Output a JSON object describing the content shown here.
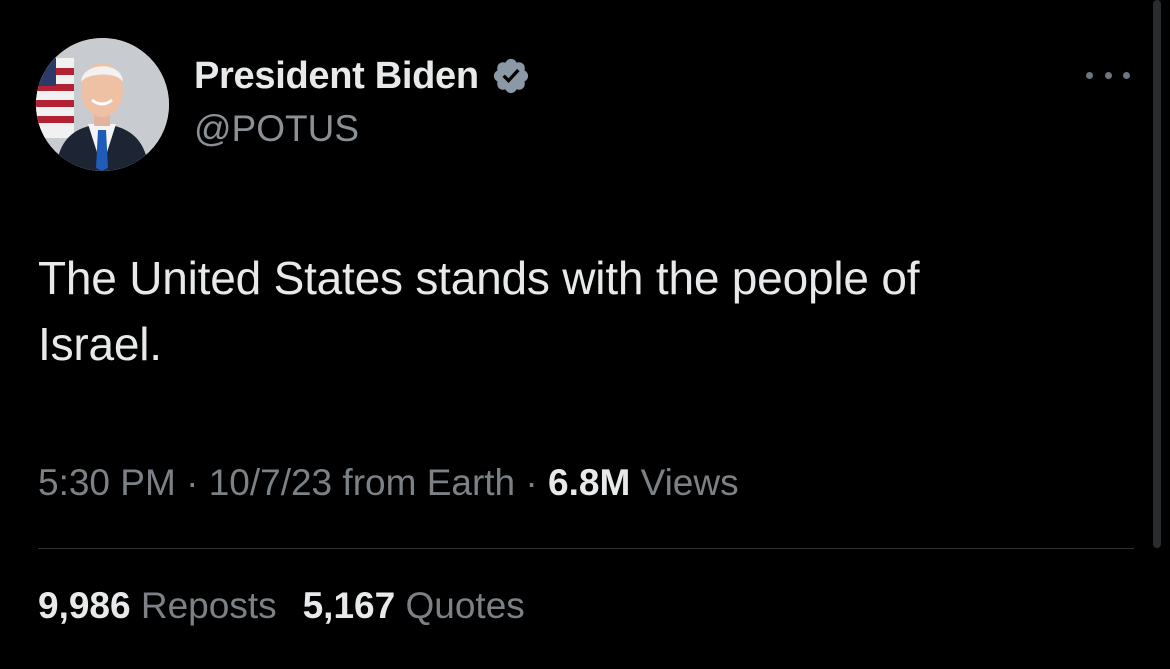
{
  "author": {
    "display_name": "President Biden",
    "handle": "@POTUS",
    "verified": true,
    "verified_color": "#8b98a5"
  },
  "tweet": {
    "text_line1": "The United States stands with the people of",
    "text_line2": "Israel."
  },
  "meta": {
    "time": "5:30 PM",
    "date": "10/7/23",
    "source": "from Earth",
    "separator": "·",
    "views_count": "6.8M",
    "views_label": "Views"
  },
  "stats": {
    "reposts_count": "9,986",
    "reposts_label": "Reposts",
    "quotes_count": "5,167",
    "quotes_label": "Quotes"
  },
  "icons": {
    "more": "more-horizontal-icon",
    "verified": "verified-badge-icon"
  },
  "colors": {
    "background": "#000000",
    "primary_text": "#e7e9ea",
    "secondary_text": "#7c8186",
    "divider": "#2f3336"
  }
}
